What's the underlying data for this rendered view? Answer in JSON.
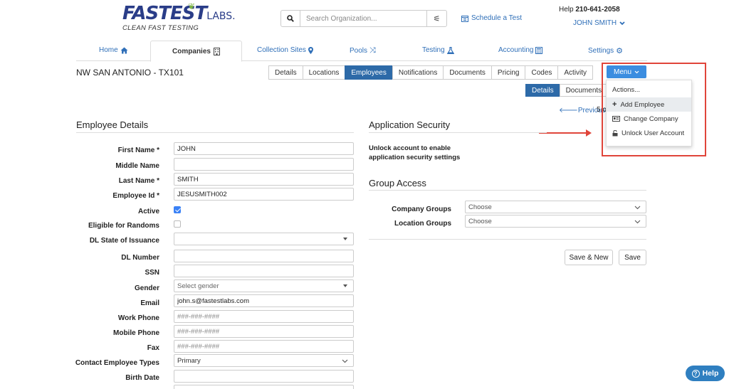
{
  "header": {
    "logo_main": "FASTEST",
    "logo_labs": "LABS.",
    "logo_sub": "CLEAN FAST TESTING",
    "search_placeholder": "Search Organization...",
    "schedule_label": "Schedule a Test",
    "help_label": "Help",
    "help_phone": "210-641-2058",
    "user_name": "JOHN SMITH"
  },
  "nav": {
    "home": "Home",
    "companies": "Companies",
    "collection_sites": "Collection Sites",
    "pools": "Pools",
    "testing": "Testing",
    "accounting": "Accounting",
    "settings": "Settings"
  },
  "company": {
    "title": "NW SAN ANTONIO - TX101"
  },
  "subtabs": [
    "Details",
    "Locations",
    "Employees",
    "Notifications",
    "Documents",
    "Pricing",
    "Codes",
    "Activity"
  ],
  "subtabs_active": "Employees",
  "menu": {
    "button_label": "Menu",
    "items": [
      "Actions...",
      "Add Employee",
      "Change Company",
      "Unlock User Account"
    ],
    "hovered": "Add Employee"
  },
  "detail_tabs": [
    "Details",
    "Documents"
  ],
  "pagination": {
    "previous": "Previous",
    "count": "5 of"
  },
  "employee": {
    "section_title": "Employee Details",
    "fields": {
      "first_name": {
        "label": "First Name *",
        "value": "JOHN"
      },
      "middle_name": {
        "label": "Middle Name",
        "value": ""
      },
      "last_name": {
        "label": "Last Name *",
        "value": "SMITH"
      },
      "employee_id": {
        "label": "Employee Id *",
        "value": "JESUSMITH002"
      },
      "active": {
        "label": "Active",
        "checked": true
      },
      "eligible": {
        "label": "Eligible for Randoms",
        "checked": false
      },
      "dl_state": {
        "label": "DL State of Issuance",
        "value": ""
      },
      "dl_number": {
        "label": "DL Number",
        "value": ""
      },
      "ssn": {
        "label": "SSN",
        "value": ""
      },
      "gender": {
        "label": "Gender",
        "value": "Select gender"
      },
      "email": {
        "label": "Email",
        "value": "john.s@fastestlabs.com"
      },
      "work_phone": {
        "label": "Work Phone",
        "placeholder": "###-###-####"
      },
      "mobile_phone": {
        "label": "Mobile Phone",
        "placeholder": "###-###-####"
      },
      "fax": {
        "label": "Fax",
        "placeholder": "###-###-####"
      },
      "contact_types": {
        "label": "Contact Employee Types",
        "value": "Primary"
      },
      "birth_date": {
        "label": "Birth Date",
        "value": ""
      }
    }
  },
  "security": {
    "section_title": "Application Security",
    "text_line1": "Unlock account to enable",
    "text_line2": "application security settings"
  },
  "group_access": {
    "section_title": "Group Access",
    "company_groups_label": "Company Groups",
    "location_groups_label": "Location Groups",
    "choose": "Choose"
  },
  "actions": {
    "save_new": "Save & New",
    "save": "Save"
  },
  "help_button": "Help",
  "colors": {
    "brand_blue": "#2a3d88",
    "link_blue": "#2f6fb8",
    "active_tab": "#2d6aa8",
    "menu_blue": "#3b8de0",
    "annotation_red": "#e0453a"
  }
}
